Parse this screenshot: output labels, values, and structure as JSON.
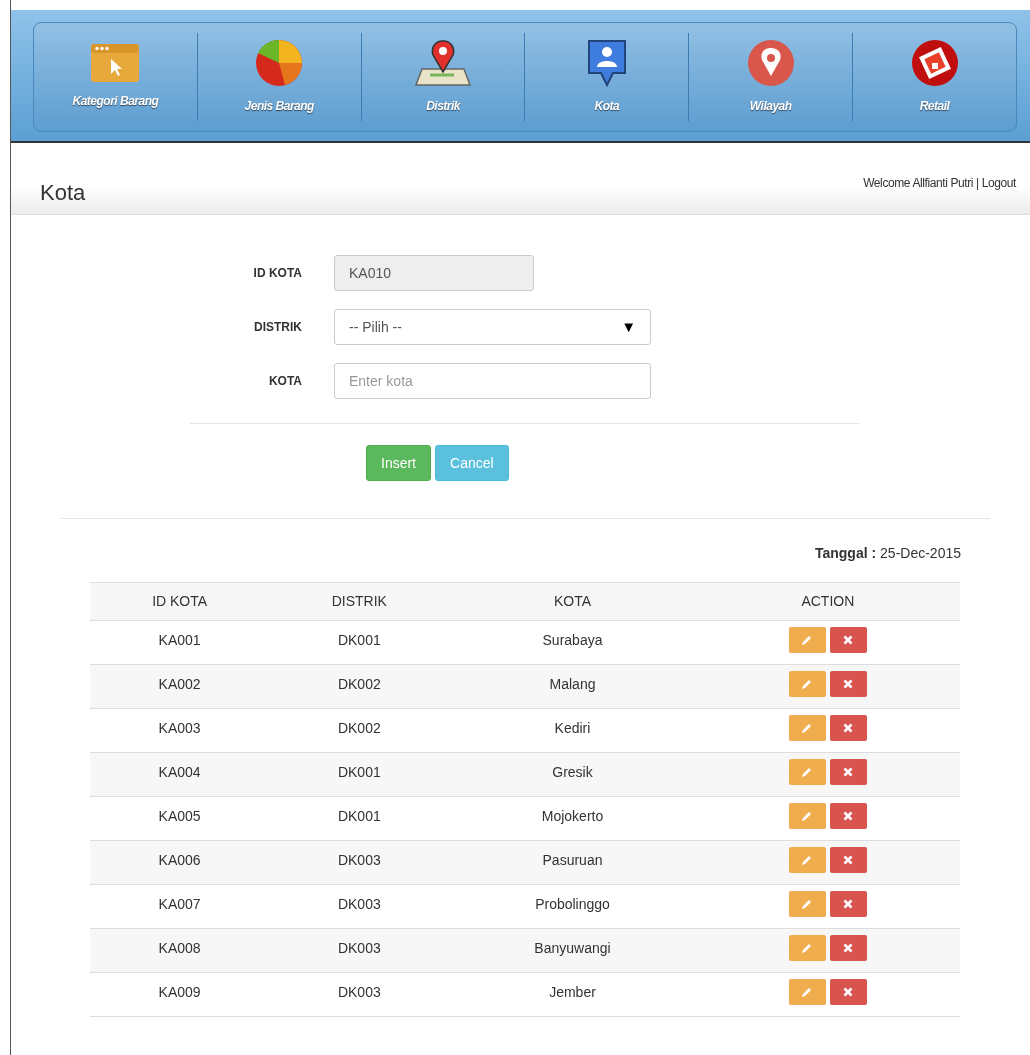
{
  "nav": [
    {
      "label": "Kategori Barang",
      "kind": "folder"
    },
    {
      "label": "Jenis Barang",
      "kind": "pie"
    },
    {
      "label": "Distrik",
      "kind": "map"
    },
    {
      "label": "Kota",
      "kind": "person"
    },
    {
      "label": "Wilayah",
      "kind": "pin"
    },
    {
      "label": "Retail",
      "kind": "retail"
    }
  ],
  "page_title": "Kota",
  "welcome": "Welcome Allfianti Putri",
  "separator": "|",
  "logout": "Logout",
  "form": {
    "fields": [
      {
        "label": "ID KOTA",
        "kind": "readonly",
        "value": "KA010"
      },
      {
        "label": "DISTRIK",
        "kind": "select",
        "value": "-- Pilih --",
        "caret": "▼"
      },
      {
        "label": "KOTA",
        "kind": "text",
        "placeholder": "Enter kota"
      }
    ],
    "buttons": [
      {
        "label": "Insert",
        "kind": "primary"
      },
      {
        "label": "Cancel",
        "kind": "secondary"
      }
    ]
  },
  "date_label": "Tanggal",
  "date_sep": ":",
  "date_value": "25-Dec-2015",
  "table": {
    "columns": [
      "ID KOTA",
      "DISTRIK",
      "KOTA",
      "ACTION"
    ],
    "rows": [
      [
        "KA001",
        "DK001",
        "Surabaya"
      ],
      [
        "KA002",
        "DK002",
        "Malang"
      ],
      [
        "KA003",
        "DK002",
        "Kediri"
      ],
      [
        "KA004",
        "DK001",
        "Gresik"
      ],
      [
        "KA005",
        "DK001",
        "Mojokerto"
      ],
      [
        "KA006",
        "DK003",
        "Pasuruan"
      ],
      [
        "KA007",
        "DK003",
        "Probolinggo"
      ],
      [
        "KA008",
        "DK003",
        "Banyuwangi"
      ],
      [
        "KA009",
        "DK003",
        "Jember"
      ]
    ]
  }
}
